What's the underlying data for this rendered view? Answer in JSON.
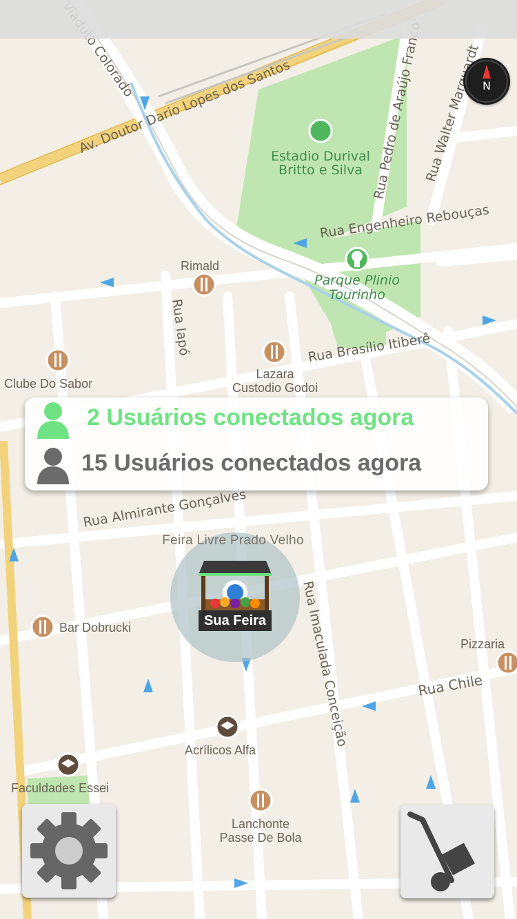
{
  "map": {
    "streets": [
      "Viaduto Colorado",
      "Av. Doutor Dario Lopes dos Santos",
      "Rua Pedro de Araújo Franco",
      "Rua Walter Marquardt",
      "Rua Engenheiro Rebouças",
      "Rua Iapó",
      "Rua Brasílio Itiberê",
      "Rua Almirante Gonçalves",
      "Rua Imaculada Conceição",
      "Rua Chile"
    ],
    "parks": [
      "Estadio Durival Britto e Silva",
      "Parque Plinio Tourinho"
    ],
    "pois": [
      {
        "name": "Rimald",
        "icon": "restaurant-icon"
      },
      {
        "name": "Lazara Custodio Godoi",
        "icon": "restaurant-icon"
      },
      {
        "name": "Clube Do Sabor",
        "icon": "restaurant-icon"
      },
      {
        "name": "Bar Dobrucki",
        "icon": "restaurant-icon"
      },
      {
        "name": "Pizzaria",
        "icon": "restaurant-icon"
      },
      {
        "name": "Acrílicos Alfa",
        "icon": "education-icon"
      },
      {
        "name": "Faculdades Essei",
        "icon": "education-icon"
      },
      {
        "name": "Lanchonte Passe De Bola",
        "icon": "restaurant-icon"
      }
    ]
  },
  "users": {
    "online": "2 Usuários conectados agora",
    "total": "15 Usuários conectados agora"
  },
  "fair": {
    "name": "Feira Livre Prado Velho",
    "marker_label": "Sua Feira"
  },
  "compass": {
    "label": "N"
  },
  "buttons": {
    "settings_icon": "gear-icon",
    "cart_icon": "hand-truck-icon"
  },
  "colors": {
    "online": "#6fe383",
    "offline": "#6b6b6b",
    "park": "#bfe6b0",
    "map_bg": "#f3efe6"
  }
}
